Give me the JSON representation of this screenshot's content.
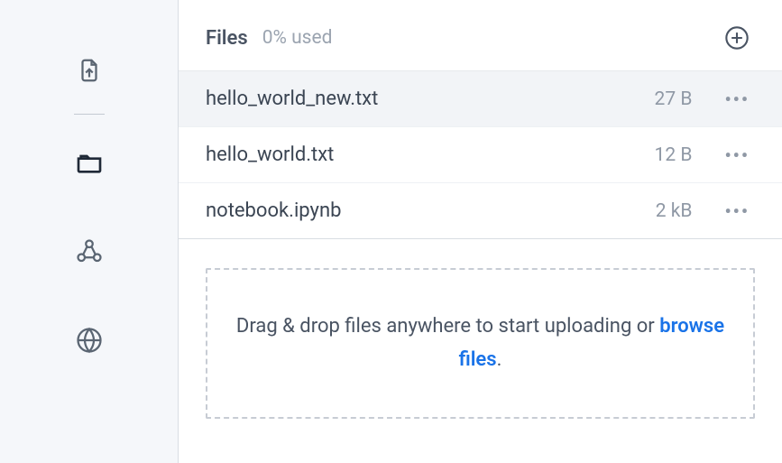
{
  "sidebar": {
    "icons": [
      "upload",
      "files",
      "share",
      "globe"
    ]
  },
  "header": {
    "title": "Files",
    "usage": "0% used"
  },
  "files": [
    {
      "name": "hello_world_new.txt",
      "size": "27 B",
      "highlighted": true
    },
    {
      "name": "hello_world.txt",
      "size": "12 B",
      "highlighted": false
    },
    {
      "name": "notebook.ipynb",
      "size": "2 kB",
      "highlighted": false
    }
  ],
  "dropzone": {
    "prefix": "Drag & drop files anywhere to start uploading or ",
    "link": "browse files",
    "suffix": "."
  }
}
